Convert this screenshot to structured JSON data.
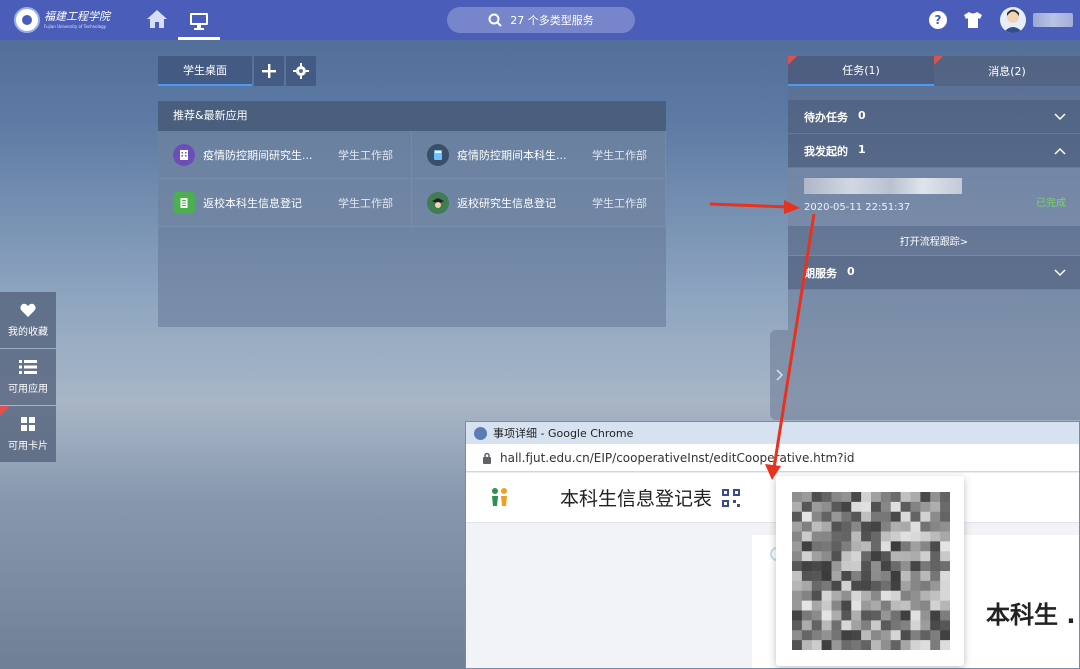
{
  "header": {
    "logo_name_cn": "福建工程学院",
    "logo_name_en": "Fujian University of Technology",
    "search_label": "27 个多类型服务"
  },
  "desk_tabs": {
    "active_label": "学生桌面"
  },
  "apps_panel": {
    "title": "推荐&最新应用",
    "items": [
      {
        "name": "疫情防控期间研究生...",
        "dept": "学生工作部",
        "icon": "building-icon",
        "icon_color": "#6a4fb8"
      },
      {
        "name": "疫情防控期间本科生...",
        "dept": "学生工作部",
        "icon": "calculator-icon",
        "icon_color": "#3b4f68"
      },
      {
        "name": "返校本科生信息登记",
        "dept": "学生工作部",
        "icon": "document-icon",
        "icon_color": "#4caf50"
      },
      {
        "name": "返校研究生信息登记",
        "dept": "学生工作部",
        "icon": "graduate-icon",
        "icon_color": "#3f7d53"
      }
    ]
  },
  "dock": {
    "items": [
      {
        "label": "我的收藏",
        "icon": "heart-icon"
      },
      {
        "label": "可用应用",
        "icon": "list-icon"
      },
      {
        "label": "可用卡片",
        "icon": "grid-icon"
      }
    ]
  },
  "task_panel": {
    "tabs": [
      {
        "label": "任务(1)",
        "active": true
      },
      {
        "label": "消息(2)",
        "active": false
      }
    ],
    "sections": [
      {
        "label": "待办任务",
        "count": "0",
        "expanded": false
      },
      {
        "label": "我发起的",
        "count": "1",
        "expanded": true
      },
      {
        "label": "期服务",
        "count": "0",
        "expanded": false
      }
    ],
    "item": {
      "time": "2020-05-11 22:51:37",
      "status": "已完成",
      "status_color": "#7cd46a"
    },
    "track_link": "打开流程跟踪>"
  },
  "chrome_window": {
    "title": "事项详细 - Google Chrome",
    "url": "hall.fjut.edu.cn/EIP/cooperativeInst/editCooperative.htm?id",
    "page_title": "本科生信息登记表",
    "card_title": "本科生 ."
  },
  "colors": {
    "topbar": "#4a5db8",
    "accent": "#4d9bf0",
    "annotation_red": "#e8321e"
  }
}
